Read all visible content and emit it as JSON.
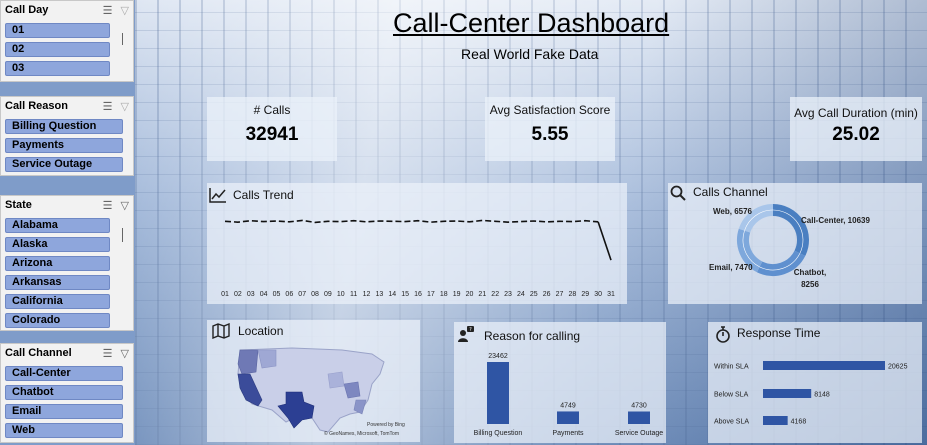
{
  "slicers": {
    "call_day": {
      "title": "Call Day",
      "items": [
        "01",
        "02",
        "03"
      ]
    },
    "call_reason": {
      "title": "Call Reason",
      "items": [
        "Billing Question",
        "Payments",
        "Service Outage"
      ]
    },
    "state": {
      "title": "State",
      "items": [
        "Alabama",
        "Alaska",
        "Arizona",
        "Arkansas",
        "California",
        "Colorado"
      ]
    },
    "call_channel": {
      "title": "Call Channel",
      "items": [
        "Call-Center",
        "Chatbot",
        "Email",
        "Web"
      ]
    }
  },
  "header": {
    "title": "Call-Center Dashboard",
    "subtitle": "Real World Fake Data"
  },
  "kpis": [
    {
      "label": "# Calls",
      "value": "32941"
    },
    {
      "label": "Avg Satisfaction Score",
      "value": "5.55"
    },
    {
      "label": "Avg Call Duration (min)",
      "value": "25.02"
    }
  ],
  "calls_trend": {
    "title": "Calls Trend",
    "days": [
      "01",
      "02",
      "03",
      "04",
      "05",
      "06",
      "07",
      "08",
      "09",
      "10",
      "11",
      "12",
      "13",
      "14",
      "15",
      "16",
      "17",
      "18",
      "19",
      "20",
      "21",
      "22",
      "23",
      "24",
      "25",
      "26",
      "27",
      "28",
      "29",
      "30",
      "31"
    ],
    "values": [
      1080,
      1065,
      1090,
      1075,
      1085,
      1070,
      1095,
      1060,
      1080,
      1075,
      1090,
      1070,
      1085,
      1080,
      1075,
      1090,
      1065,
      1080,
      1085,
      1070,
      1095,
      1080,
      1065,
      1075,
      1085,
      1070,
      1080,
      1075,
      1090,
      1070,
      400
    ],
    "ylim": [
      0,
      1400
    ]
  },
  "calls_channel": {
    "title": "Calls Channel",
    "slices": [
      {
        "name": "Call-Center",
        "value": 10639,
        "label": "Call-Center, 10639",
        "color": "#4a7fc1"
      },
      {
        "name": "Chatbot",
        "value": 8256,
        "label": "Chatbot,",
        "label2": "8256",
        "color": "#5f90cf"
      },
      {
        "name": "Email",
        "value": 7470,
        "label": "Email, 7470",
        "color": "#7ea8dc"
      },
      {
        "name": "Web",
        "value": 6576,
        "label": "Web, 6576",
        "color": "#a9c6ea"
      }
    ]
  },
  "location": {
    "title": "Location",
    "attribution1": "Powered by Bing",
    "attribution2": "© GeoNames, Microsoft, TomTom"
  },
  "reason": {
    "title": "Reason for calling",
    "categories": [
      "Billing Question",
      "Payments",
      "Service Outage"
    ],
    "values": [
      23462,
      4749,
      4730
    ],
    "color": "#2f55a4"
  },
  "response": {
    "title": "Response Time",
    "categories": [
      "Within SLA",
      "Below SLA",
      "Above SLA"
    ],
    "values": [
      20625,
      8148,
      4168
    ],
    "color": "#2f55a4"
  }
}
